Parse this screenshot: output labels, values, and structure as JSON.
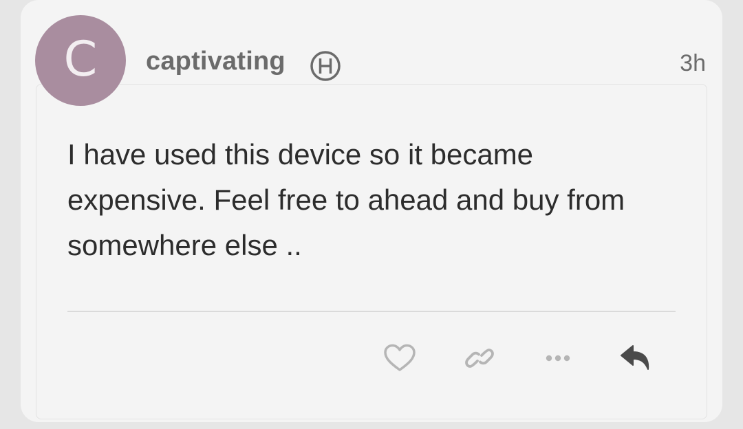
{
  "post": {
    "avatar_letter": "C",
    "username": "captivating",
    "badge_icon": "h-circle-badge-icon",
    "timestamp": "3h",
    "body": "I have used this device so it became expensive. Feel free to ahead and buy from somewhere else ..",
    "actions": [
      {
        "name": "like",
        "icon": "heart-icon"
      },
      {
        "name": "copy-link",
        "icon": "link-icon"
      },
      {
        "name": "more",
        "icon": "ellipsis-icon"
      },
      {
        "name": "reply",
        "icon": "reply-icon"
      }
    ]
  },
  "colors": {
    "avatar_bg": "#a98d9f",
    "username": "#6b6b6b",
    "body_text": "#2c2c2c",
    "icon_muted": "#b5b5b5",
    "icon_dark": "#4a4a4a"
  }
}
